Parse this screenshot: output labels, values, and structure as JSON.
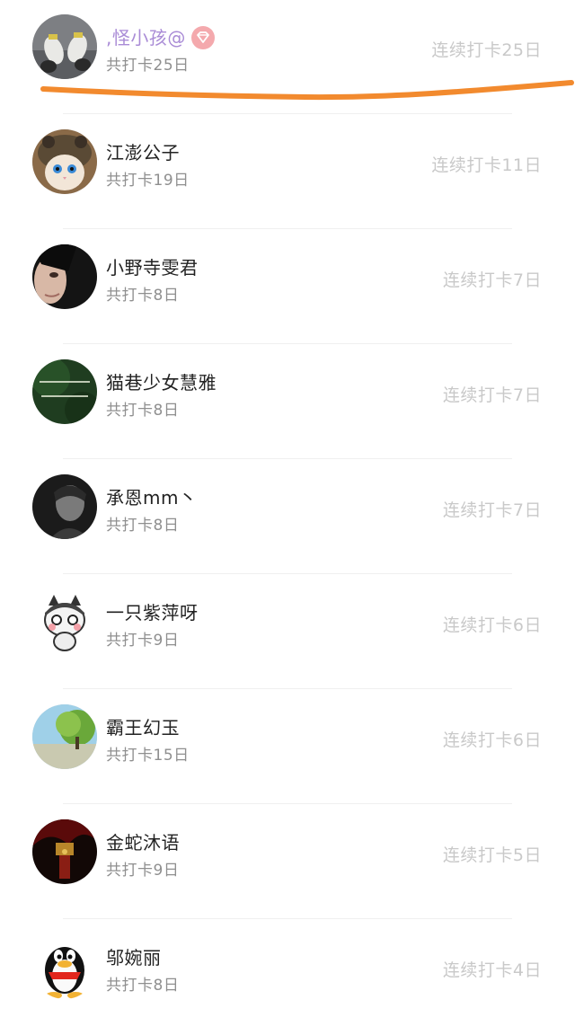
{
  "rows": [
    {
      "name": ",怪小孩@",
      "total": "共打卡25日",
      "streak": "连续打卡25日",
      "vip": true,
      "avatar": "shoes-photo-avatar"
    },
    {
      "name": "江澎公子",
      "total": "共打卡19日",
      "streak": "连续打卡11日",
      "vip": false,
      "avatar": "cat-hat-avatar"
    },
    {
      "name": "小野寺雯君",
      "total": "共打卡8日",
      "streak": "连续打卡7日",
      "vip": false,
      "avatar": "face-dark-avatar"
    },
    {
      "name": "猫巷少女慧雅",
      "total": "共打卡8日",
      "streak": "连续打卡7日",
      "vip": false,
      "avatar": "green-text-avatar"
    },
    {
      "name": "承恩mm丶",
      "total": "共打卡8日",
      "streak": "连续打卡7日",
      "vip": false,
      "avatar": "bw-portrait-avatar"
    },
    {
      "name": "一只紫萍呀",
      "total": "共打卡9日",
      "streak": "连续打卡6日",
      "vip": false,
      "avatar": "husky-cartoon-avatar"
    },
    {
      "name": "霸王幻玉",
      "total": "共打卡15日",
      "streak": "连续打卡6日",
      "vip": false,
      "avatar": "landscape-tree-avatar"
    },
    {
      "name": "金蛇沐语",
      "total": "共打卡9日",
      "streak": "连续打卡5日",
      "vip": false,
      "avatar": "red-dark-avatar"
    },
    {
      "name": "邬婉丽",
      "total": "共打卡8日",
      "streak": "连续打卡4日",
      "vip": false,
      "avatar": "qq-penguin-avatar"
    }
  ],
  "colors": {
    "vip_name": "#a98bd6",
    "vip_badge": "#f4a9ad",
    "highlight_stroke": "#f28a2e"
  }
}
